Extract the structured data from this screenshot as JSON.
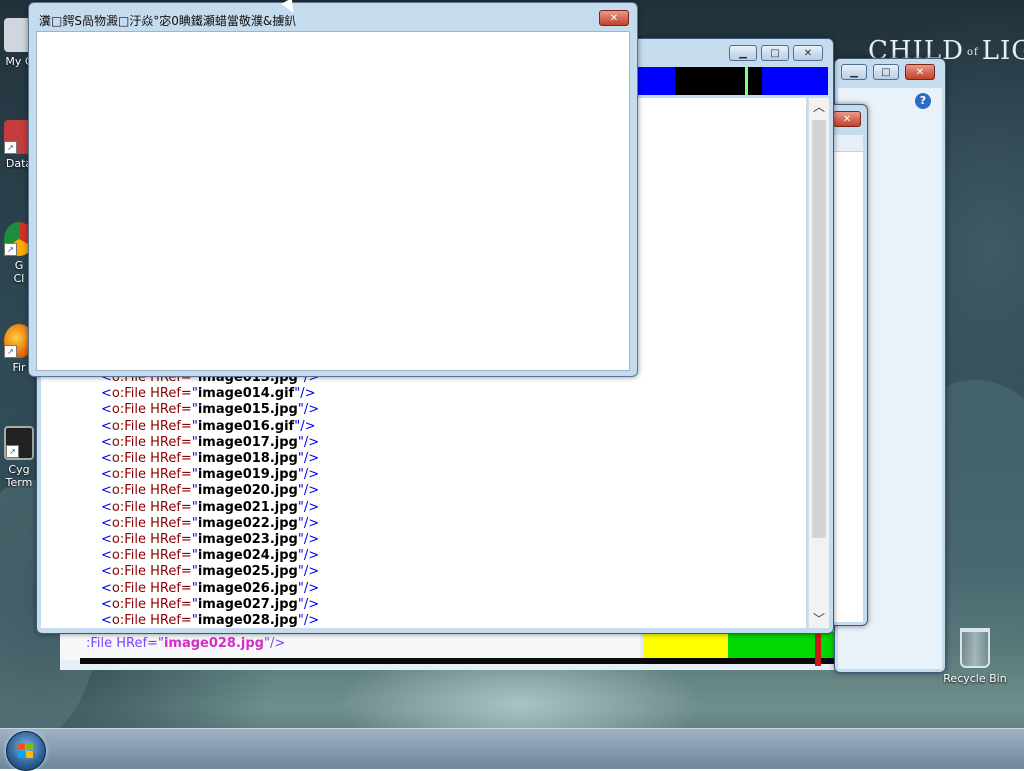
{
  "desktop": {
    "brand": {
      "pre": "CHILD",
      "of": "of",
      "post": "LIGHT"
    },
    "icons": [
      {
        "label": "My C",
        "icon": "computer-icon"
      },
      {
        "label": "Data",
        "icon": "shortcut-icon"
      },
      {
        "label": "G",
        "label2": "Cl",
        "icon": "chrome-icon"
      },
      {
        "label": "Fir",
        "icon": "firefox-icon"
      },
      {
        "label": "Cyg",
        "label2": "Term",
        "icon": "cygwin-icon"
      }
    ],
    "recycle_bin": {
      "label": "Recycle Bin"
    }
  },
  "dialog": {
    "title": "瀵□鍔S咼物澱□汙焱°宓0睓鐵瀬蜡當敬濮&擄釟",
    "close_label": "✕"
  },
  "editor": {
    "lines": [
      {
        "prefix": "<",
        "tag": "o:File HRef=",
        "q1": "\"",
        "value": "image013.jpg",
        "q2": "\"",
        "end": "/>"
      },
      {
        "prefix": "<",
        "tag": "o:File HRef=",
        "q1": "\"",
        "value": "image014.gif",
        "q2": "\"",
        "end": "/>"
      },
      {
        "prefix": "<",
        "tag": "o:File HRef=",
        "q1": "\"",
        "value": "image015.jpg",
        "q2": "\"",
        "end": "/>"
      },
      {
        "prefix": "<",
        "tag": "o:File HRef=",
        "q1": "\"",
        "value": "image016.gif",
        "q2": "\"",
        "end": "/>"
      },
      {
        "prefix": "<",
        "tag": "o:File HRef=",
        "q1": "\"",
        "value": "image017.jpg",
        "q2": "\"",
        "end": "/>"
      },
      {
        "prefix": "<",
        "tag": "o:File HRef=",
        "q1": "\"",
        "value": "image018.jpg",
        "q2": "\"",
        "end": "/>"
      },
      {
        "prefix": "<",
        "tag": "o:File HRef=",
        "q1": "\"",
        "value": "image019.jpg",
        "q2": "\"",
        "end": "/>"
      },
      {
        "prefix": "<",
        "tag": "o:File HRef=",
        "q1": "\"",
        "value": "image020.jpg",
        "q2": "\"",
        "end": "/>"
      },
      {
        "prefix": "<",
        "tag": "o:File HRef=",
        "q1": "\"",
        "value": "image021.jpg",
        "q2": "\"",
        "end": "/>"
      },
      {
        "prefix": "<",
        "tag": "o:File HRef=",
        "q1": "\"",
        "value": "image022.jpg",
        "q2": "\"",
        "end": "/>"
      },
      {
        "prefix": "<",
        "tag": "o:File HRef=",
        "q1": "\"",
        "value": "image023.jpg",
        "q2": "\"",
        "end": "/>"
      },
      {
        "prefix": "<",
        "tag": "o:File HRef=",
        "q1": "\"",
        "value": "image024.jpg",
        "q2": "\"",
        "end": "/>"
      },
      {
        "prefix": "<",
        "tag": "o:File HRef=",
        "q1": "\"",
        "value": "image025.jpg",
        "q2": "\"",
        "end": "/>"
      },
      {
        "prefix": "<",
        "tag": "o:File HRef=",
        "q1": "\"",
        "value": "image026.jpg",
        "q2": "\"",
        "end": "/>"
      },
      {
        "prefix": "<",
        "tag": "o:File HRef=",
        "q1": "\"",
        "value": "image027.jpg",
        "q2": "\"",
        "end": "/>"
      },
      {
        "prefix": "<",
        "tag": "o:File HRef=",
        "q1": "\"",
        "value": "image028.jpg",
        "q2": "\"",
        "end": "/>"
      }
    ],
    "ghost_line": {
      "tag": ":File HRef=\"",
      "value": "image028.jpg",
      "end": "\"/>"
    },
    "scroll_up": "︿",
    "scroll_down": "﹀"
  },
  "window_buttons": {
    "minimize": "▁",
    "maximize": "□",
    "close": "✕"
  },
  "help_label": "?",
  "colors": {
    "titlebar": "#c5dbee",
    "close_button": "#c2402b",
    "xml_tag": "#8b0000",
    "xml_bracket": "#0000ee"
  }
}
